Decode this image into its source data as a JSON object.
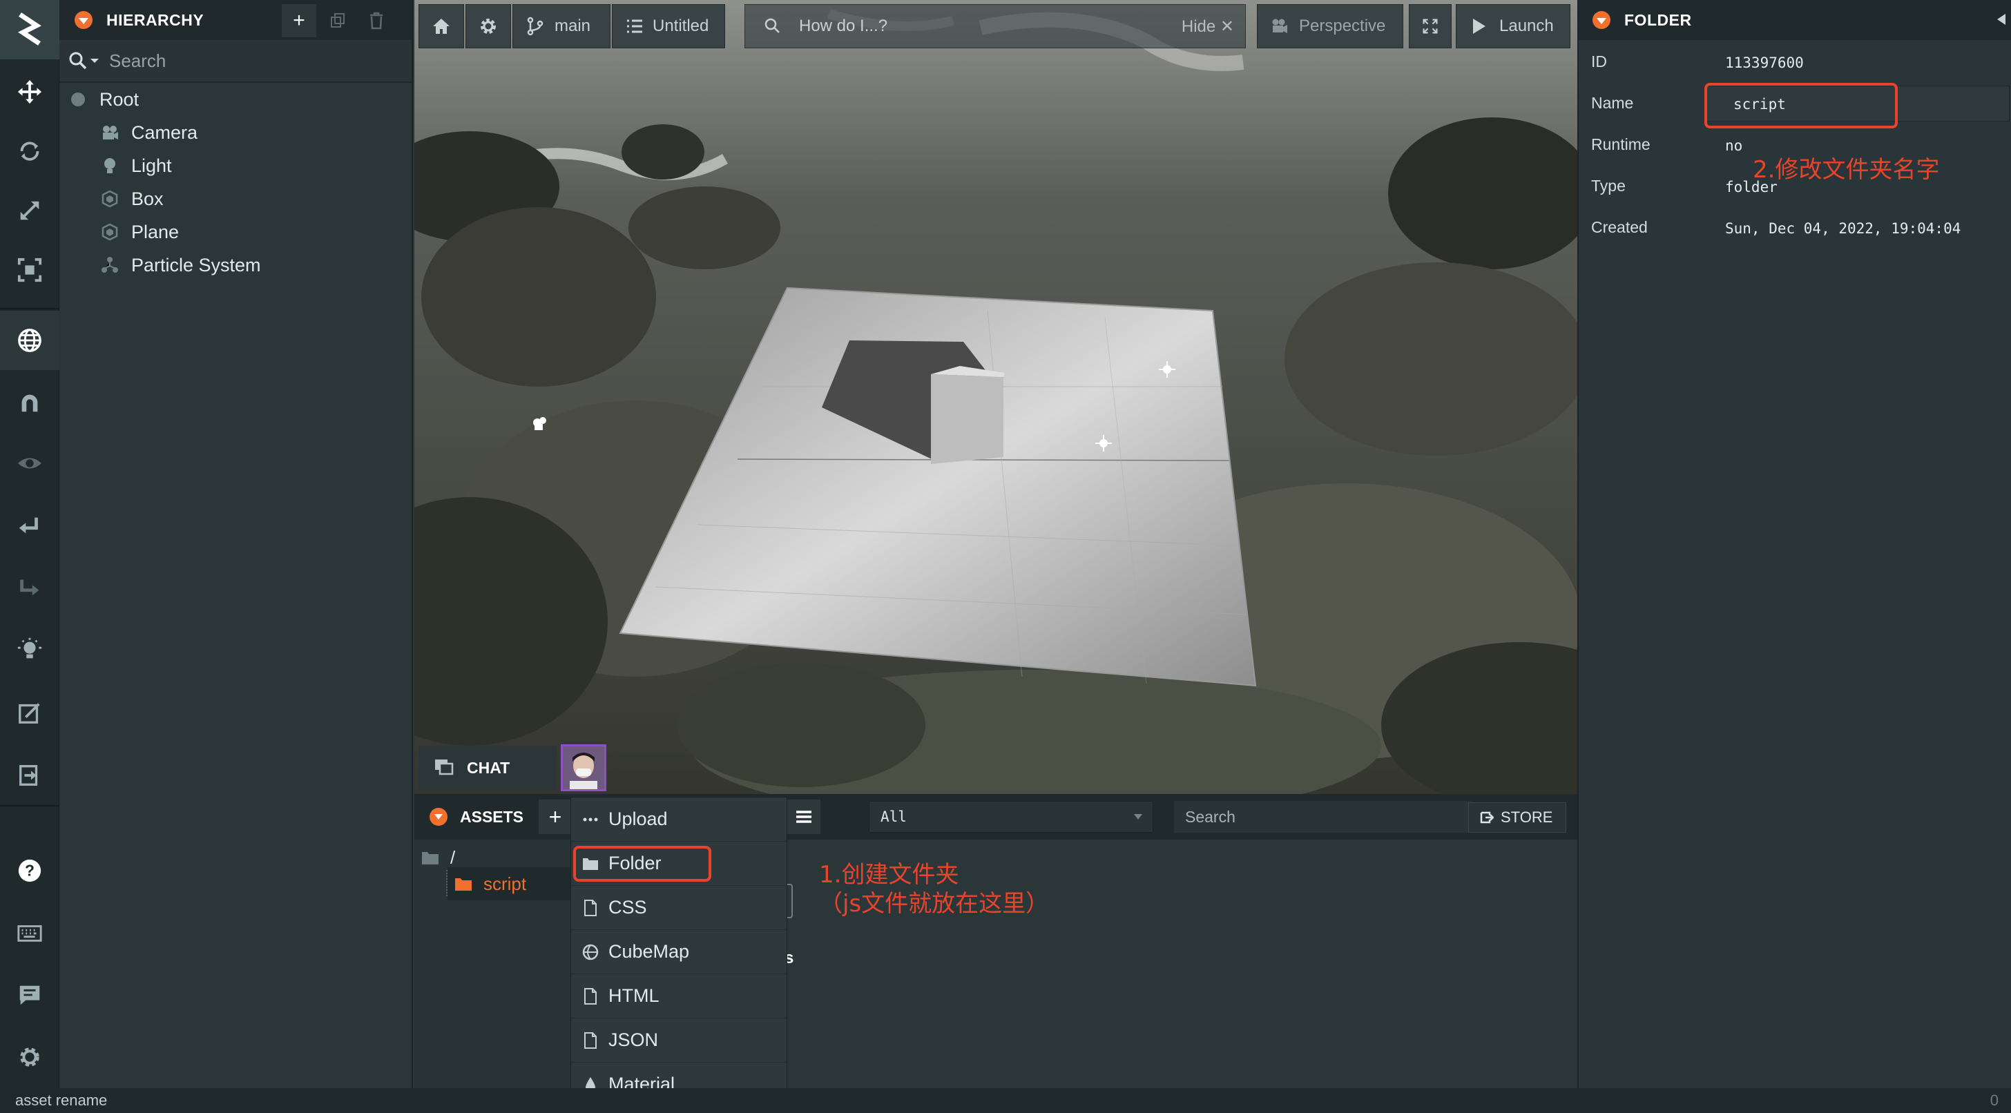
{
  "hierarchy": {
    "title": "HIERARCHY",
    "search_placeholder": "Search",
    "items": [
      {
        "label": "Root",
        "icon": "root-dot-icon"
      },
      {
        "label": "Camera",
        "icon": "camera-icon"
      },
      {
        "label": "Light",
        "icon": "light-bulb-icon"
      },
      {
        "label": "Box",
        "icon": "model-icon"
      },
      {
        "label": "Plane",
        "icon": "model-icon"
      },
      {
        "label": "Particle System",
        "icon": "particles-icon"
      }
    ]
  },
  "topbar": {
    "branch": "main",
    "scene": "Untitled",
    "search_text": "How do I...?",
    "hide_label": "Hide",
    "camera_mode": "Perspective",
    "launch_label": "Launch"
  },
  "chat": {
    "label": "CHAT"
  },
  "assets": {
    "title": "ASSETS",
    "filter_value": "All",
    "search_placeholder": "Search",
    "store_label": "STORE",
    "tree": [
      {
        "label": "/"
      },
      {
        "label": "script"
      }
    ],
    "partial_char": "s"
  },
  "add_menu": {
    "items": [
      "Upload",
      "Folder",
      "CSS",
      "CubeMap",
      "HTML",
      "JSON",
      "Material"
    ]
  },
  "inspector": {
    "title": "FOLDER",
    "fields": [
      {
        "label": "ID",
        "value": "113397600"
      },
      {
        "label": "Name",
        "value": "script"
      },
      {
        "label": "Runtime",
        "value": "no"
      },
      {
        "label": "Type",
        "value": "folder"
      },
      {
        "label": "Created",
        "value": "Sun, Dec 04, 2022, 19:04:04"
      }
    ]
  },
  "annotations": {
    "step1_line1": "1.创建文件夹",
    "step1_line2": "（js文件就放在这里）",
    "step2": "2.修改文件夹名字"
  },
  "status": {
    "text": "asset rename",
    "count": "0"
  },
  "colors": {
    "accent": "#f0702f",
    "annotation": "#e8442c",
    "panel": "#2b3639",
    "header": "#20292b"
  }
}
